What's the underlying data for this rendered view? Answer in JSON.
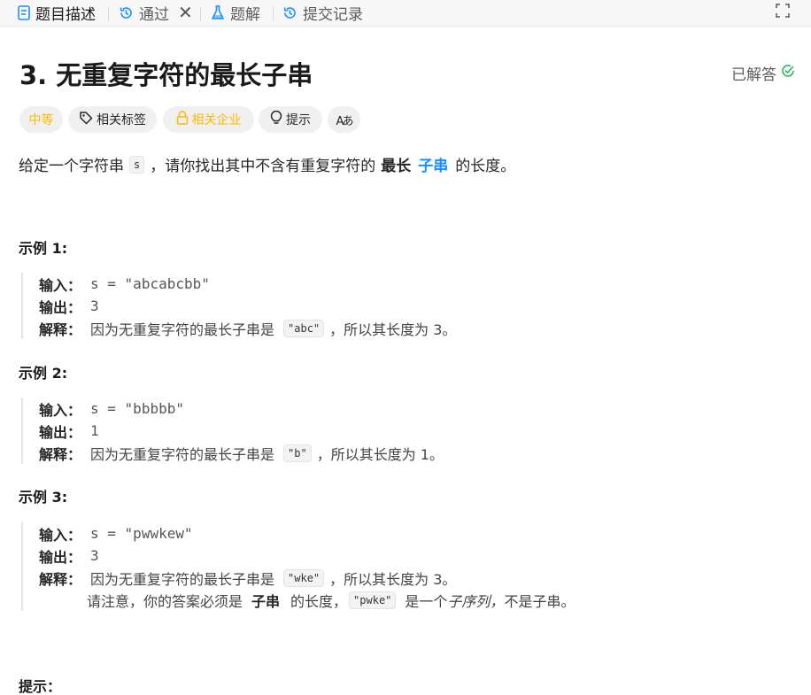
{
  "tabs": [
    {
      "label": "题目描述",
      "icon": "document-icon"
    },
    {
      "label": "通过",
      "icon": "history-icon"
    },
    {
      "label": "题解",
      "icon": "flask-icon"
    },
    {
      "label": "提交记录",
      "icon": "history-icon"
    }
  ],
  "tab_close": "✕",
  "problem": {
    "title": "3. 无重复字符的最长子串",
    "status": "已解答"
  },
  "chips": {
    "difficulty": "中等",
    "tags": "相关标签",
    "companies": "相关企业",
    "hint": "提示",
    "translate": "Aあ"
  },
  "description": {
    "prefix": "给定一个字符串",
    "var": "s",
    "middle": "，请你找出其中不含有重复字符的",
    "bold": "最长",
    "link": "子串",
    "suffix": "的长度。"
  },
  "labels": {
    "input": "输入：",
    "output": "输出：",
    "explain": "解释："
  },
  "examples": [
    {
      "heading": "示例 1:",
      "input": "s = \"abcabcbb\"",
      "output": "3",
      "explain_prefix": "因为无重复字符的最长子串是",
      "explain_code": "\"abc\"",
      "explain_suffix": "，所以其长度为 3。"
    },
    {
      "heading": "示例 2:",
      "input": "s = \"bbbbb\"",
      "output": "1",
      "explain_prefix": "因为无重复字符的最长子串是",
      "explain_code": "\"b\"",
      "explain_suffix": "，所以其长度为 1。"
    },
    {
      "heading": "示例 3:",
      "input": "s = \"pwwkew\"",
      "output": "3",
      "explain_prefix": "因为无重复字符的最长子串是",
      "explain_code": "\"wke\"",
      "explain_suffix": "，所以其长度为 3。",
      "note_prefix": "请注意，你的答案必须是",
      "note_bold": "子串",
      "note_mid": "的长度，",
      "note_code": "\"pwke\"",
      "note_mid2": "是一个",
      "note_italic": "子序列，",
      "note_suffix": "不是子串。"
    }
  ],
  "hints_heading": "提示：",
  "colors": {
    "accent_blue": "#1a90ff",
    "difficulty_medium": "#ffb800",
    "solved_green": "#2db55d"
  }
}
